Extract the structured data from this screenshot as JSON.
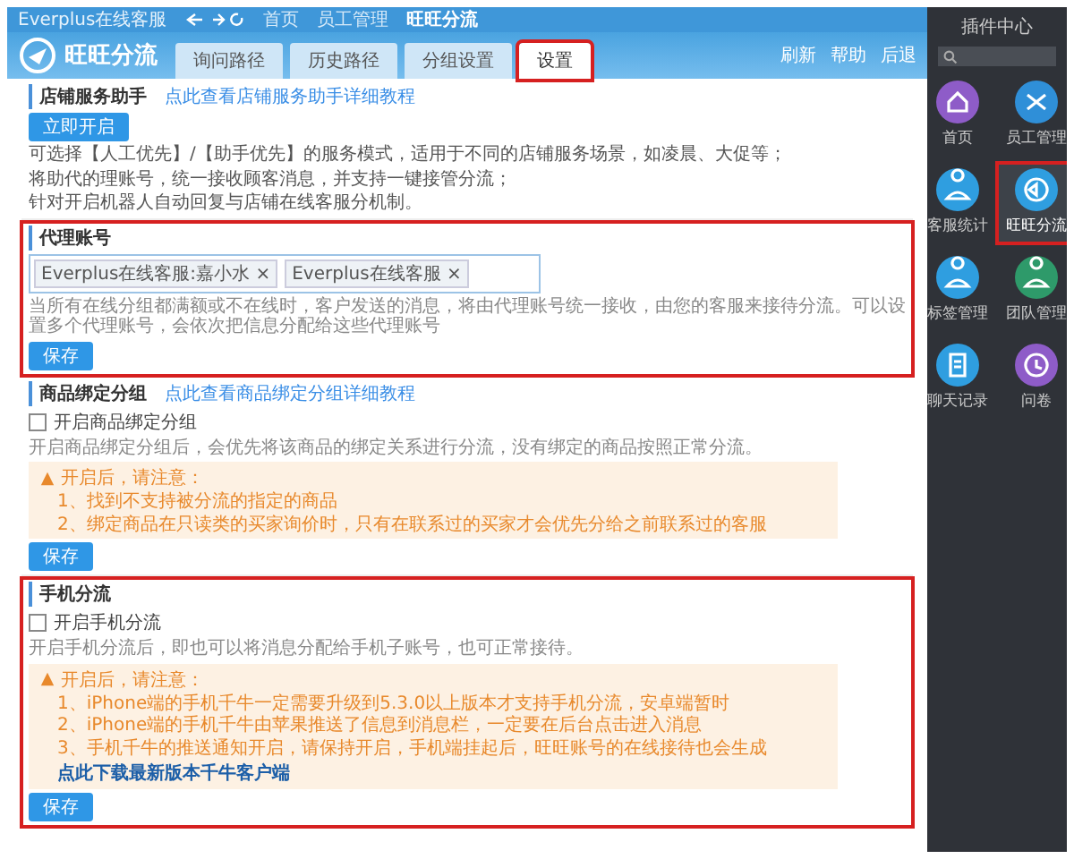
{
  "topbar": {
    "app_name": "Everplus在线客服",
    "nav": [
      {
        "label": "首页",
        "selected": false
      },
      {
        "label": "员工管理",
        "selected": false
      },
      {
        "label": "旺旺分流",
        "selected": true
      }
    ]
  },
  "header": {
    "logo_text": "旺旺分流",
    "tabs": [
      {
        "label": "询问路径",
        "selected": false,
        "highlighted": false
      },
      {
        "label": "历史路径",
        "selected": false,
        "highlighted": false
      },
      {
        "label": "分组设置",
        "selected": false,
        "highlighted": false
      },
      {
        "label": "设置",
        "selected": true,
        "highlighted": true
      }
    ],
    "actions": [
      "刷新",
      "帮助",
      "后退"
    ]
  },
  "sections": [
    {
      "title": "店铺服务助手",
      "link": "点此查看店铺服务助手详细教程",
      "start_button": "立即开启",
      "lines": [
        "可选择【人工优先】/【助手优先】的服务模式，适用于不同的店铺服务场景，如凌晨、大促等；",
        "将助代的理账号，统一接收顾客消息，并支持一键接管分流；",
        "针对开启机器人自动回复与店铺在线客服分机制。"
      ],
      "highlighted": false
    },
    {
      "title": "代理账号",
      "tags": [
        "Everplus在线客服:嘉小水 ×",
        "Everplus在线客服 ×"
      ],
      "hint": "当所有在线分组都满额或不在线时，客户发送的消息，将由代理账号统一接收，由您的客服来接待分流。可以设置多个代理账号，会依次把信息分配给这些代理账号",
      "save_button": "保存",
      "highlighted": true
    },
    {
      "title": "商品绑定分组",
      "link": "点此查看商品绑定分组详细教程",
      "checkbox": {
        "label": "开启商品绑定分组",
        "checked": false
      },
      "description": "开启商品绑定分组后，会优先将该商品的绑定关系进行分流，没有绑定的商品按照正常分流。",
      "warning": {
        "title": "开启后，请注意：",
        "items": [
          "1、找到不支持被分流的指定的商品",
          "2、绑定商品在只读类的买家询价时，只有在联系过的买家才会优先分给之前联系过的客服"
        ]
      },
      "save_button": "保存",
      "highlighted": false
    },
    {
      "title": "手机分流",
      "checkbox": {
        "label": "开启手机分流",
        "checked": false
      },
      "description": "开启手机分流后，即也可以将消息分配给手机子账号，也可正常接待。",
      "warning": {
        "title": "开启后，请注意：",
        "items": [
          "1、iPhone端的手机千牛一定需要升级到5.3.0以上版本才支持手机分流，安卓端暂时",
          "2、iPhone端的手机千牛由苹果推送了信息到消息栏，一定要在后台点击进入消息",
          "3、手机千牛的推送通知开启，请保持开启，手机端挂起后，旺旺账号的在线接待也会生成"
        ],
        "link": "点此下载最新版本千牛客户端"
      },
      "save_button": "保存",
      "highlighted": true
    }
  ],
  "sidebar": {
    "title": "插件中心",
    "items": [
      {
        "label": "首页",
        "color": "#8e5cc8",
        "selected": false,
        "highlighted": false
      },
      {
        "label": "员工管理",
        "color": "#2f8fd8",
        "selected": false,
        "highlighted": false
      },
      {
        "label": "客服统计",
        "color": "#2f9ee0",
        "selected": false,
        "highlighted": false
      },
      {
        "label": "旺旺分流",
        "color": "#2f9ee0",
        "selected": true,
        "highlighted": true
      },
      {
        "label": "标签管理",
        "color": "#2f9ee0",
        "selected": false,
        "highlighted": false
      },
      {
        "label": "团队管理",
        "color": "#2e9a6a",
        "selected": false,
        "highlighted": false
      },
      {
        "label": "聊天记录",
        "color": "#2f9ee0",
        "selected": false,
        "highlighted": false
      },
      {
        "label": "问卷",
        "color": "#8e5cc8",
        "selected": false,
        "highlighted": false
      }
    ]
  }
}
